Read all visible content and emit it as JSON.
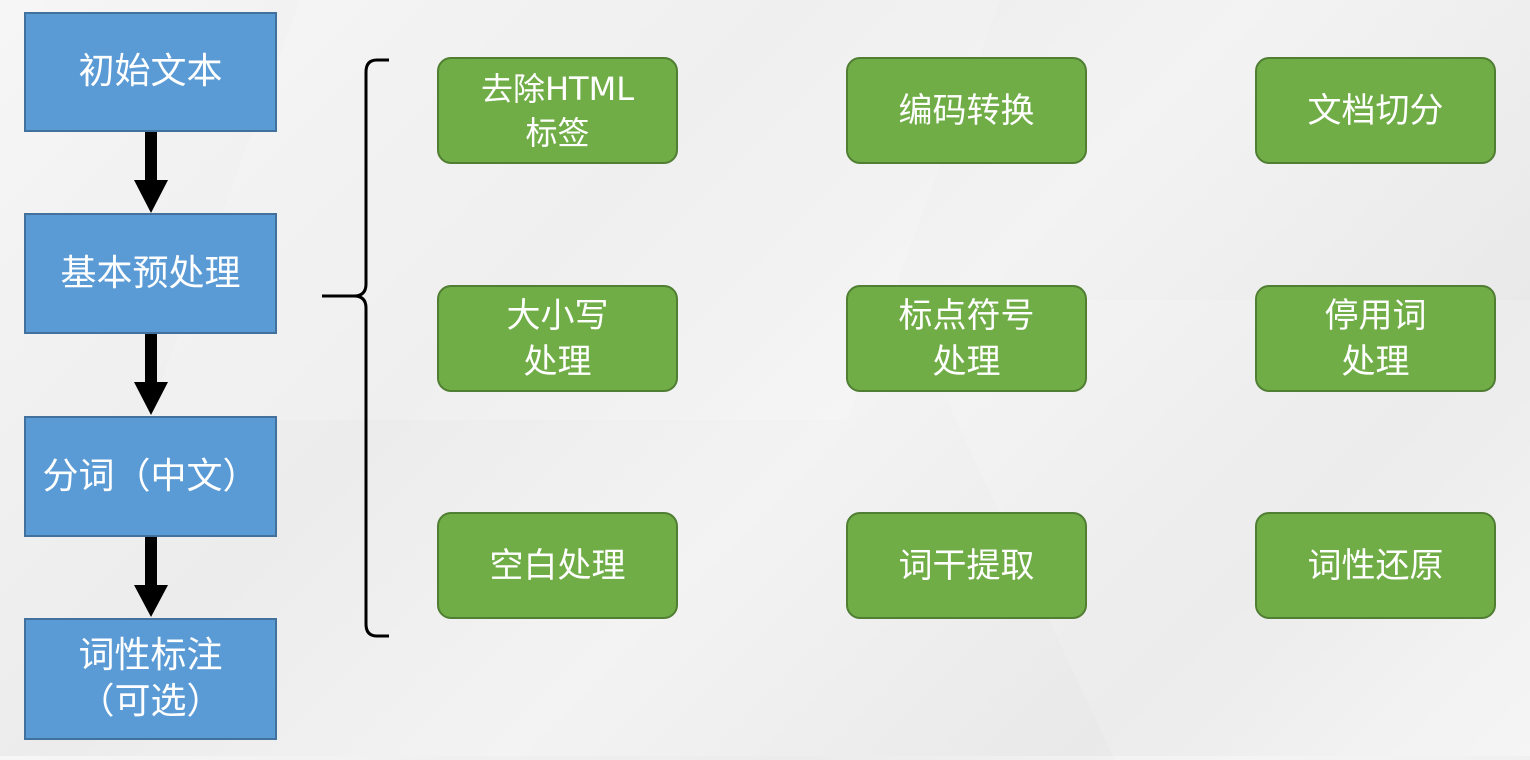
{
  "pipeline": {
    "steps": [
      {
        "label": "初始文本"
      },
      {
        "label": "基本预处理"
      },
      {
        "label": "分词（中文）"
      },
      {
        "label": "词性标注\n（可选）"
      }
    ]
  },
  "preprocessing": {
    "tasks": [
      {
        "label": "去除HTML\n标签"
      },
      {
        "label": "编码转换"
      },
      {
        "label": "文档切分"
      },
      {
        "label": "大小写\n处理"
      },
      {
        "label": "标点符号\n处理"
      },
      {
        "label": "停用词\n处理"
      },
      {
        "label": "空白处理"
      },
      {
        "label": "词干提取"
      },
      {
        "label": "词性还原"
      }
    ]
  },
  "colors": {
    "step_fill": "#5b9bd5",
    "task_fill": "#70ad47",
    "arrow": "#000000"
  }
}
